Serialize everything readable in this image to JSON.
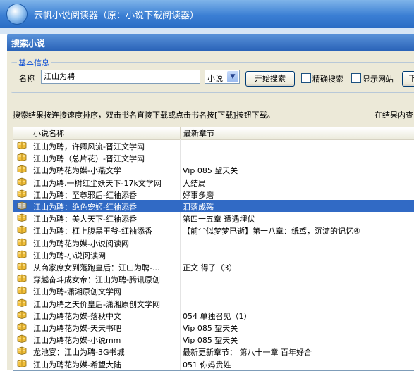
{
  "app": {
    "title": "云帆小说阅读器（原：小说下载阅读器）"
  },
  "dialog": {
    "title": "搜索小说"
  },
  "search": {
    "group_label": "基本信息",
    "name_label": "名称",
    "query": "江山为聘",
    "category": "小说",
    "start_button": "开始搜索",
    "exact_label": "精确搜索",
    "show_site_label": "显示网站",
    "extra_button": "下"
  },
  "info": {
    "sort_hint": "搜索结果按连接速度排序，双击书名直接下载或点击书名按[下载]按钮下载。",
    "right_hint": "在结果内查"
  },
  "table": {
    "col_name": "小说名称",
    "col_chapter": "最新章节",
    "rows": [
      {
        "name": "江山为聘，许卿风流-晋江文学网",
        "chapter": ""
      },
      {
        "name": "江山为聘（总片花）-晋江文学网",
        "chapter": ""
      },
      {
        "name": "江山为聘花为媒-小燕文学",
        "chapter": "Vip 085 望天关"
      },
      {
        "name": "江山为聘.一树红尘妖天下-17k文学网",
        "chapter": "大结局"
      },
      {
        "name": "江山为聘：至尊邪后-红袖添香",
        "chapter": "好事多磨"
      },
      {
        "name": "江山为聘：绝色宠姬-红袖添香",
        "chapter": "泪落成殇",
        "selected": true
      },
      {
        "name": "江山为聘：美人天下-红袖添香",
        "chapter": "第四十五章 遭遇埋伏"
      },
      {
        "name": "江山为聘：杠上腹黑王爷-红袖添香",
        "chapter": "【前尘似梦梦已逝】第十八章：纸鸢，沉淀的记忆④"
      },
      {
        "name": "江山为聘花为媒-小说阅读网",
        "chapter": ""
      },
      {
        "name": "江山为聘-小说阅读网",
        "chapter": ""
      },
      {
        "name": "从商家庶女到落跑皇后：江山为聘-...",
        "chapter": "正文 得子（3）"
      },
      {
        "name": "穿越奋斗成女帝：江山为聘-腾讯原创",
        "chapter": ""
      },
      {
        "name": "江山为聘-潇湘原创文学网",
        "chapter": ""
      },
      {
        "name": "江山为聘之天价皇后-潇湘原创文学网",
        "chapter": ""
      },
      {
        "name": "江山为聘花为媒-落秋中文",
        "chapter": "054 单独召见（1）"
      },
      {
        "name": "江山为聘花为媒-天天书吧",
        "chapter": "Vip 085 望天关"
      },
      {
        "name": "江山为聘花为媒-小说mm",
        "chapter": "Vip 085 望天关"
      },
      {
        "name": "龙池宴：江山为聘-3G书城",
        "chapter": "最新更新章节： 第八十一章 百年好合"
      },
      {
        "name": "江山为聘花为媒-希望大陆",
        "chapter": "051 你妈贵姓"
      }
    ]
  },
  "colors": {
    "title_bar": "#3b7fd4",
    "dialog_title": "#2a63b8",
    "selection": "#316ac5",
    "book_icon": "#f3c03a"
  },
  "icons": {
    "row_icon": "book-icon",
    "dropdown": "chevron-down-icon"
  }
}
